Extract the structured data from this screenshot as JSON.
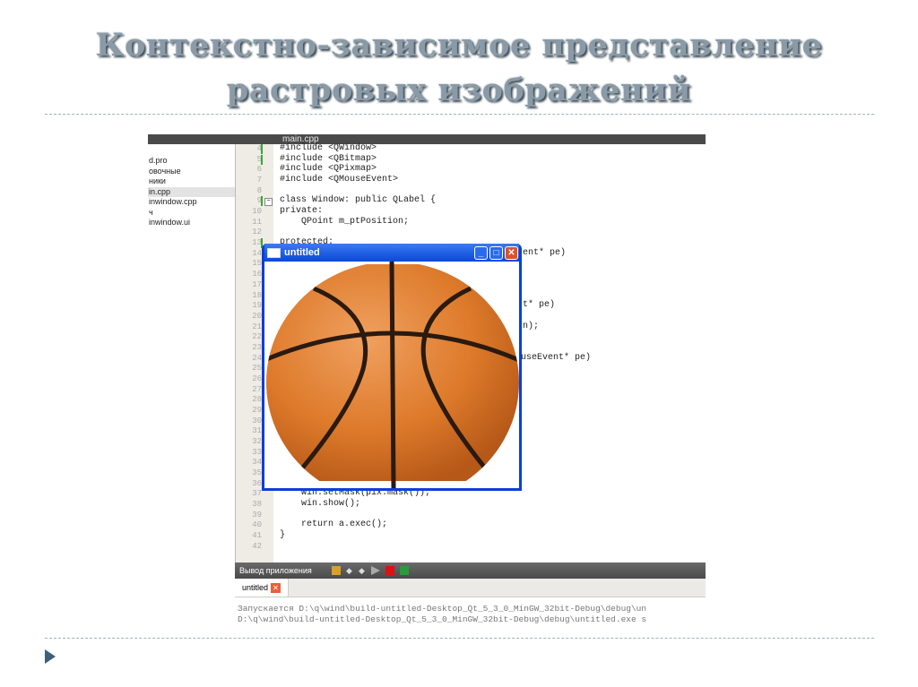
{
  "slide": {
    "title_line1": "Контекстно-зависимое представление",
    "title_line2": "растровых изображений"
  },
  "ide": {
    "file_tab": "main.cpp",
    "sidebar": [
      "d.pro",
      "овочные",
      "ники",
      "in.cpp",
      "inwindow.cpp",
      "ч",
      "inwindow.ui"
    ],
    "lines": [
      {
        "n": "4",
        "t": "#include <QWindow>"
      },
      {
        "n": "5",
        "t": "#include <QBitmap>"
      },
      {
        "n": "6",
        "t": "#include <QPixmap>"
      },
      {
        "n": "7",
        "t": "#include <QMouseEvent>"
      },
      {
        "n": "8",
        "t": ""
      },
      {
        "n": "9",
        "t": "class Window: public QLabel {"
      },
      {
        "n": "10",
        "t": "private:"
      },
      {
        "n": "11",
        "t": "    QPoint m_ptPosition;"
      },
      {
        "n": "12",
        "t": ""
      },
      {
        "n": "13",
        "t": "protected:"
      }
    ],
    "fragments": [
      {
        "n": "14",
        "t": "ent* pe)"
      },
      {
        "n": "19",
        "t": "t* pe)"
      },
      {
        "n": "21",
        "t": "n);"
      },
      {
        "n": "24",
        "t": "ouseEvent* pe)"
      }
    ],
    "tail": [
      {
        "n": "37",
        "t": "    win.setMask(pix.mask());"
      },
      {
        "n": "38",
        "t": "    win.show();"
      },
      {
        "n": "39",
        "t": ""
      },
      {
        "n": "40",
        "t": "    return a.exec();"
      },
      {
        "n": "41",
        "t": "}"
      },
      {
        "n": "42",
        "t": ""
      }
    ],
    "hidden_numbers": [
      "15",
      "16",
      "17",
      "18",
      "20",
      "22",
      "23",
      "25",
      "26",
      "27",
      "28",
      "29",
      "30",
      "31",
      "32",
      "33",
      "34",
      "35",
      "36"
    ],
    "output": {
      "panel_title": "Вывод приложения",
      "tab": "untitled",
      "line1": "Запускается D:\\q\\wind\\build-untitled-Desktop_Qt_5_3_0_MinGW_32bit-Debug\\debug\\un",
      "line2": "D:\\q\\wind\\build-untitled-Desktop_Qt_5_3_0_MinGW_32bit-Debug\\debug\\untitled.exe s"
    }
  },
  "window": {
    "title": "untitled",
    "minimize": "_",
    "maximize": "□",
    "close": "✕"
  }
}
